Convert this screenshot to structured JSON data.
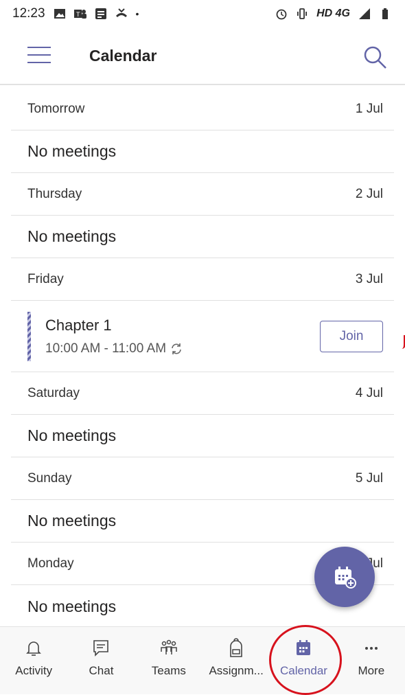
{
  "status_bar": {
    "time": "12:23",
    "network": "HD 4G"
  },
  "header": {
    "title": "Calendar"
  },
  "days": [
    {
      "day": "Tomorrow",
      "date": "1 Jul",
      "empty_text": "No meetings"
    },
    {
      "day": "Thursday",
      "date": "2 Jul",
      "empty_text": "No meetings"
    },
    {
      "day": "Friday",
      "date": "3 Jul"
    },
    {
      "day": "Saturday",
      "date": "4 Jul",
      "empty_text": "No meetings"
    },
    {
      "day": "Sunday",
      "date": "5 Jul",
      "empty_text": "No meetings"
    },
    {
      "day": "Monday",
      "date": "6 Jul",
      "empty_text": "No meetings"
    }
  ],
  "meeting": {
    "title": "Chapter 1",
    "time": "10:00 AM - 11:00 AM",
    "join_label": "Join"
  },
  "tabs": [
    {
      "label": "Activity",
      "icon": "bell-icon"
    },
    {
      "label": "Chat",
      "icon": "chat-icon"
    },
    {
      "label": "Teams",
      "icon": "teams-icon"
    },
    {
      "label": "Assignm...",
      "icon": "backpack-icon"
    },
    {
      "label": "Calendar",
      "icon": "calendar-icon",
      "active": true
    },
    {
      "label": "More",
      "icon": "more-icon"
    }
  ],
  "colors": {
    "accent": "#6264a7",
    "annotation": "#d7121d"
  }
}
